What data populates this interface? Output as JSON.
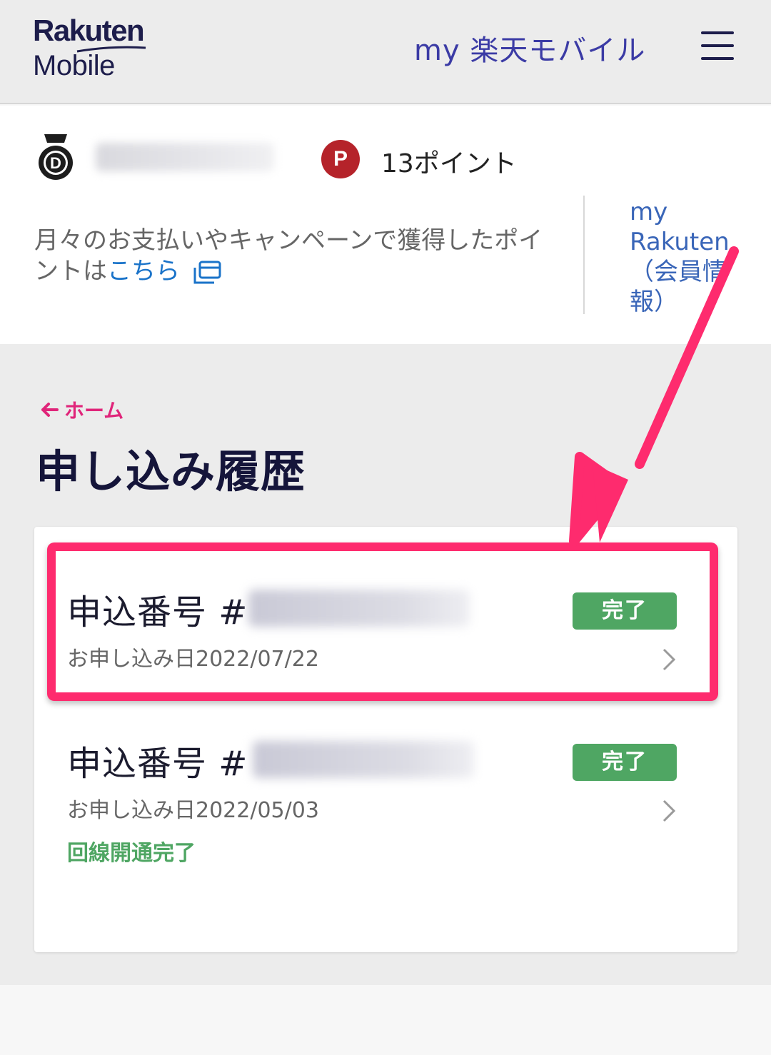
{
  "header": {
    "logo_line1": "Rakuten",
    "logo_line2": "Mobile",
    "title": "my 楽天モバイル",
    "menu_icon": "hamburger-icon"
  },
  "account": {
    "rank_icon": "medal-d-icon",
    "points_icon_letter": "P",
    "points_text": "13ポイント",
    "note_text": "月々のお支払いやキャンペーンで獲得したポイントは",
    "note_link": "こちら",
    "external_icon": "external-link-icon",
    "member_link": "my Rakuten（会員情報）"
  },
  "nav": {
    "back_label": "ホーム",
    "back_icon": "arrow-left-icon"
  },
  "page": {
    "title": "申し込み履歴"
  },
  "orders": [
    {
      "number_label": "申込番号 #",
      "date_label": "お申し込み日2022/07/22",
      "badge": "完了",
      "status": ""
    },
    {
      "number_label": "申込番号 #",
      "date_label": "お申し込み日2022/05/03",
      "badge": "完了",
      "status": "回線開通完了"
    }
  ],
  "colors": {
    "brand_dark": "#1d1d4b",
    "title_blue": "#3b3ba5",
    "accent_pink": "#e0257a",
    "annotation_pink": "#fe2b6e",
    "success_green": "#4fa663",
    "point_red": "#b5232a"
  }
}
